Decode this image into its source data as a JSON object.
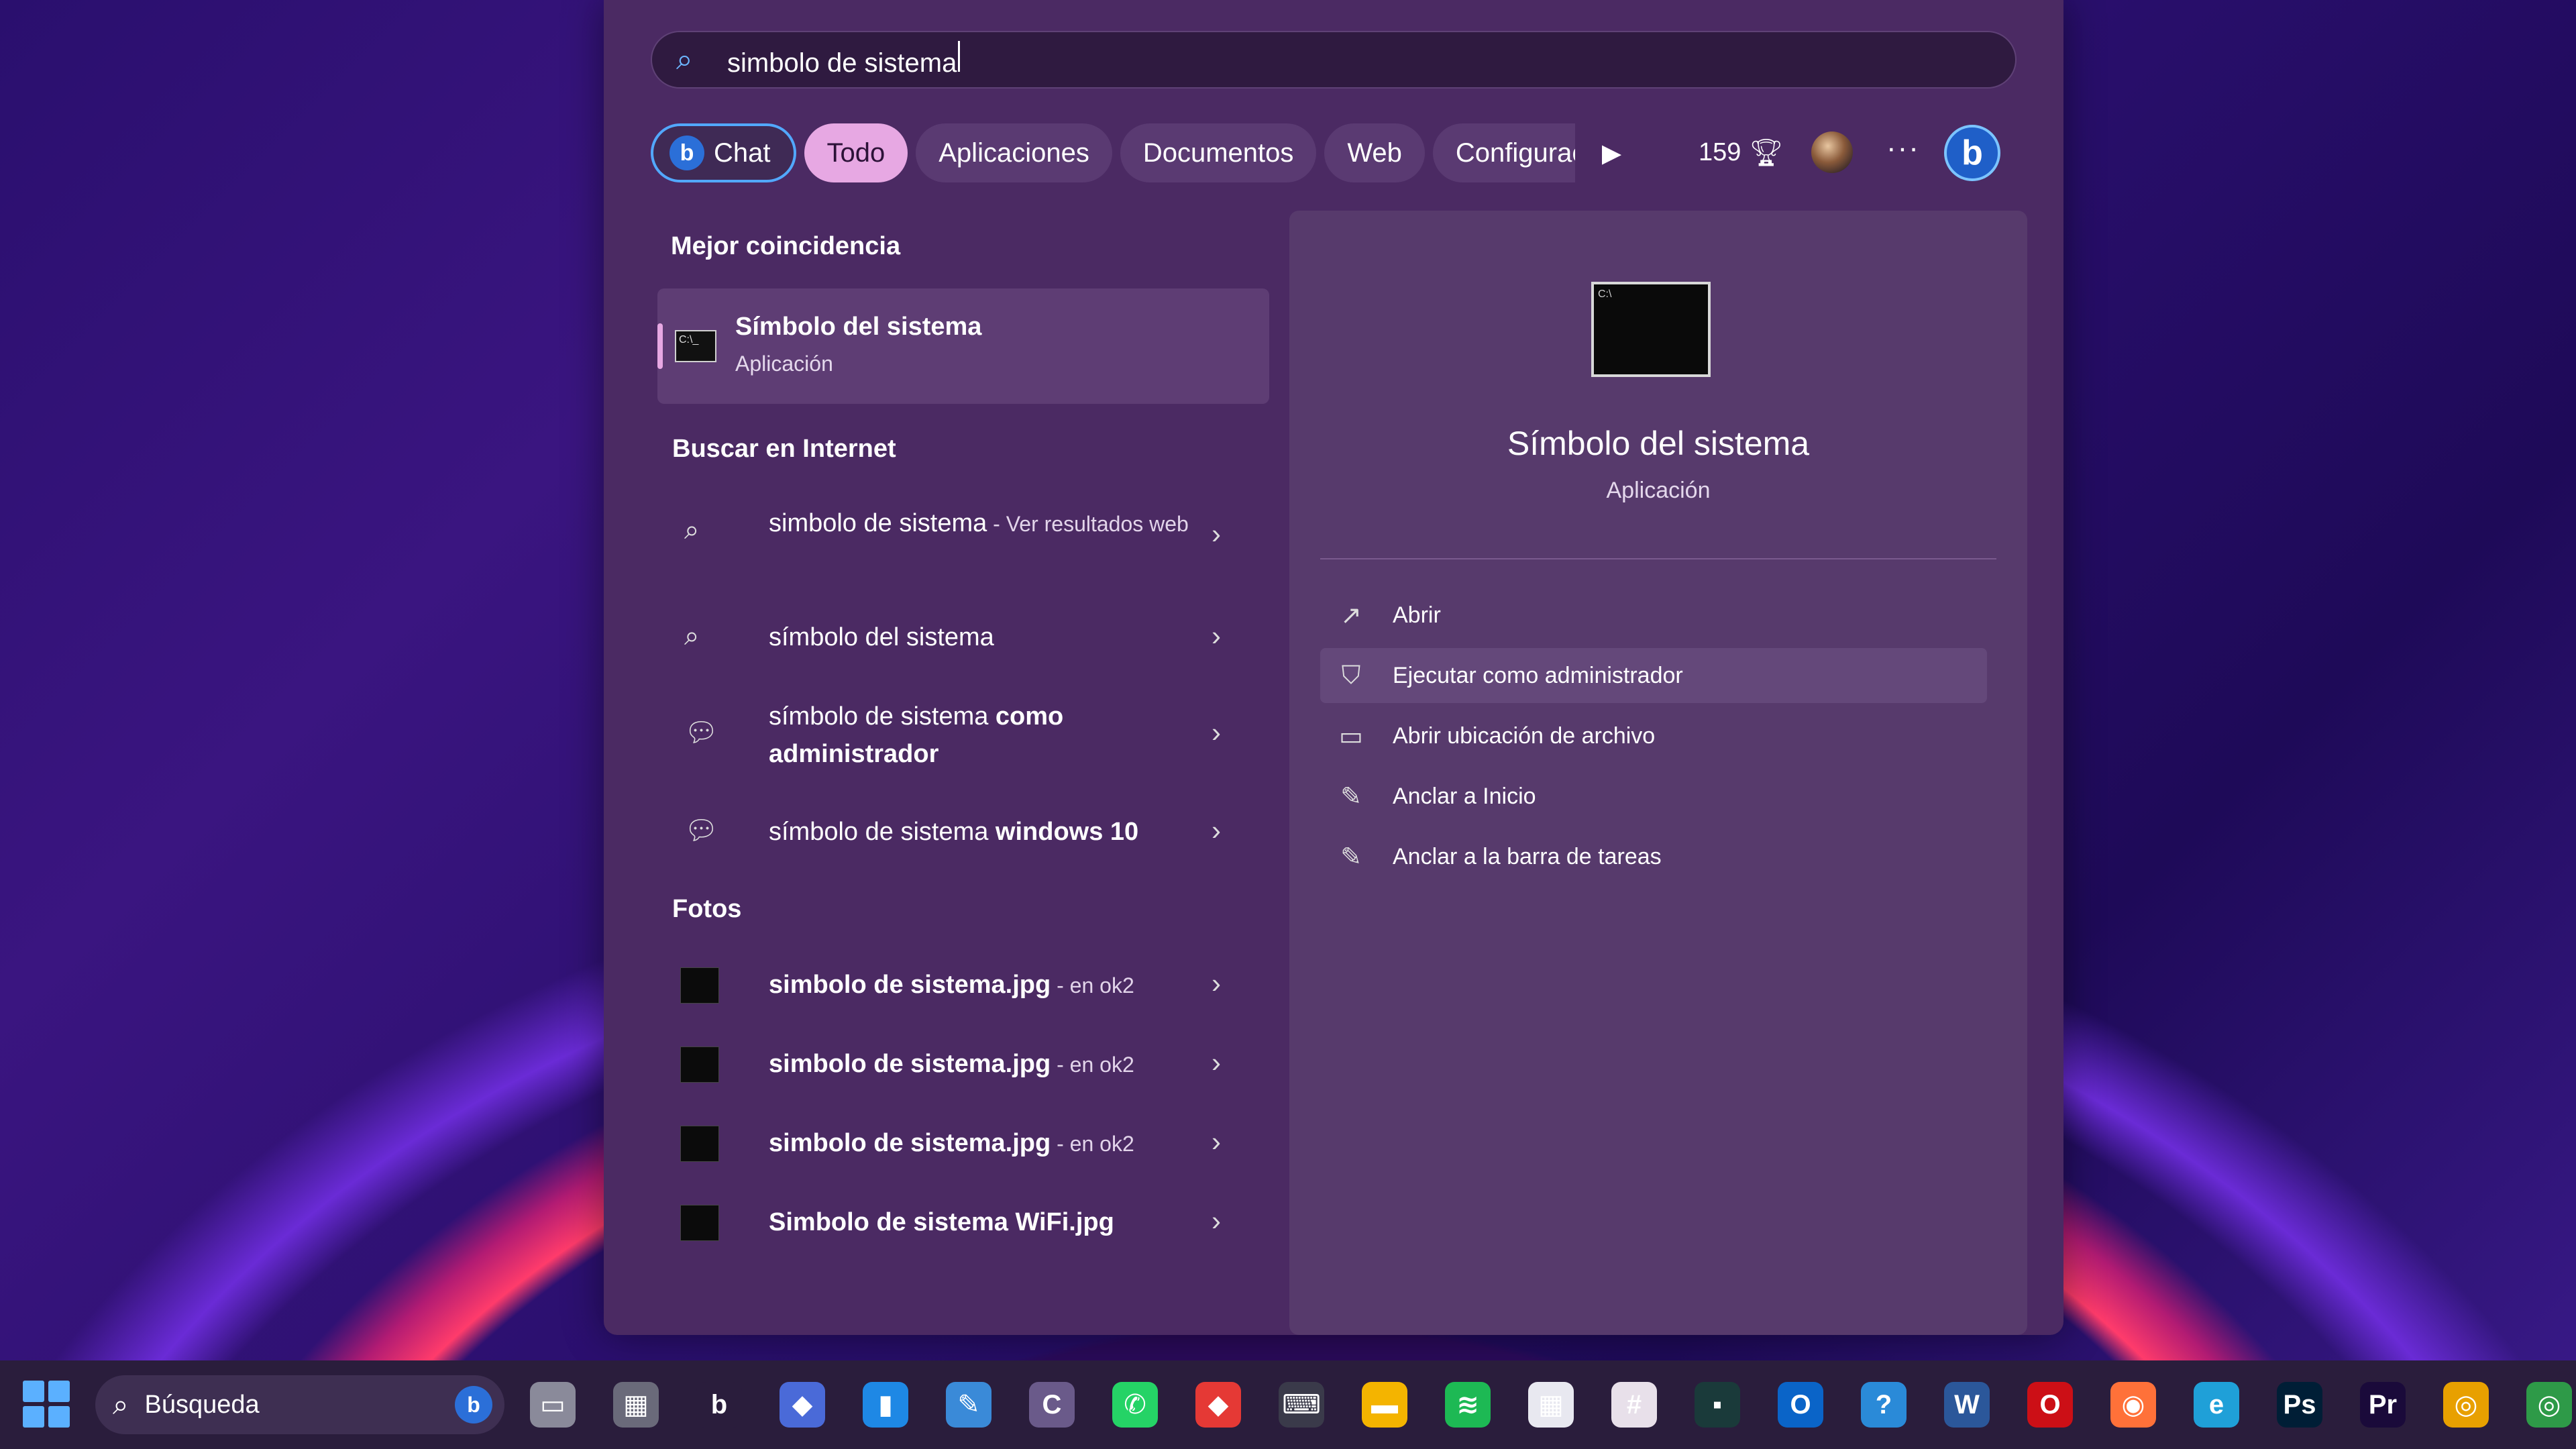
{
  "search": {
    "query": "simbolo de sistema"
  },
  "filters": {
    "chat": "Chat",
    "todo": "Todo",
    "aplicaciones": "Aplicaciones",
    "documentos": "Documentos",
    "web": "Web",
    "configuracion": "Configurac",
    "points": "159"
  },
  "best_match": {
    "section": "Mejor coincidencia",
    "title": "Símbolo del sistema",
    "subtitle": "Aplicación"
  },
  "internet": {
    "section": "Buscar en Internet",
    "items": [
      {
        "text": "simbolo de sistema",
        "suffix": " - Ver resultados web"
      },
      {
        "text": "símbolo del sistema"
      },
      {
        "text": "símbolo de sistema ",
        "bold": "como administrador"
      },
      {
        "text": "símbolo de sistema ",
        "bold": "windows 10"
      }
    ]
  },
  "photos": {
    "section": "Fotos",
    "items": [
      {
        "name": "simbolo de sistema.jpg",
        "loc": " - en ok2"
      },
      {
        "name": "simbolo de sistema.jpg",
        "loc": " - en ok2"
      },
      {
        "name": "simbolo de sistema.jpg",
        "loc": " - en ok2"
      },
      {
        "name": "Simbolo de sistema WiFi.jpg"
      }
    ]
  },
  "details": {
    "title": "Símbolo del sistema",
    "subtitle": "Aplicación",
    "actions": [
      "Abrir",
      "Ejecutar como administrador",
      "Abrir ubicación de archivo",
      "Anclar a Inicio",
      "Anclar a la barra de tareas"
    ]
  },
  "taskbar": {
    "search_label": "Búsqueda",
    "icons": [
      {
        "name": "task-view-icon",
        "glyph": "▭",
        "color": "#8a8a9a"
      },
      {
        "name": "calculator-icon",
        "glyph": "▦",
        "color": "#6a6a7a"
      },
      {
        "name": "bing-icon",
        "glyph": "b",
        "color": "#2a1d3c"
      },
      {
        "name": "copilot-icon",
        "glyph": "◆",
        "color": "#4a6ad8"
      },
      {
        "name": "app-blue-icon",
        "glyph": "▮",
        "color": "#1e88e5"
      },
      {
        "name": "paint-icon",
        "glyph": "✎",
        "color": "#3a8ad8"
      },
      {
        "name": "app-c-icon",
        "glyph": "C",
        "color": "#6a5a8a"
      },
      {
        "name": "whatsapp-icon",
        "glyph": "✆",
        "color": "#25d366"
      },
      {
        "name": "anydesk-icon",
        "glyph": "◆",
        "color": "#e53935"
      },
      {
        "name": "keyboard-icon",
        "glyph": "⌨",
        "color": "#3a3a4a"
      },
      {
        "name": "file-explorer-icon",
        "glyph": "▬",
        "color": "#f4b400"
      },
      {
        "name": "spotify-icon",
        "glyph": "≋",
        "color": "#1db954"
      },
      {
        "name": "store-icon",
        "glyph": "▦",
        "color": "#e8e8f0"
      },
      {
        "name": "slack-icon",
        "glyph": "#",
        "color": "#e8e0ea"
      },
      {
        "name": "terminal-icon",
        "glyph": "▪",
        "color": "#1a3a3a"
      },
      {
        "name": "outlook-icon",
        "glyph": "O",
        "color": "#0a64c8"
      },
      {
        "name": "help-icon",
        "glyph": "?",
        "color": "#2a8ad8"
      },
      {
        "name": "word-icon",
        "glyph": "W",
        "color": "#2b579a"
      },
      {
        "name": "opera-icon",
        "glyph": "O",
        "color": "#cc0f16"
      },
      {
        "name": "firefox-icon",
        "glyph": "◉",
        "color": "#ff7139"
      },
      {
        "name": "edge-icon",
        "glyph": "e",
        "color": "#1fa0d8"
      },
      {
        "name": "photoshop-icon",
        "glyph": "Ps",
        "color": "#001e36"
      },
      {
        "name": "premiere-icon",
        "glyph": "Pr",
        "color": "#1a0a3a"
      },
      {
        "name": "chrome-icon",
        "glyph": "◎",
        "color": "#e8a000"
      },
      {
        "name": "chrome-profile-icon",
        "glyph": "◎",
        "color": "#2e9a48"
      }
    ]
  }
}
